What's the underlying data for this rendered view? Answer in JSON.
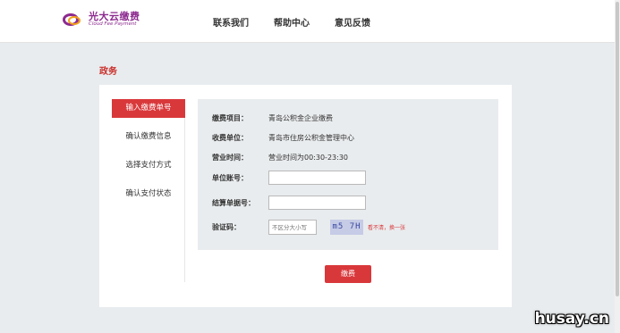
{
  "brand": {
    "name_cn": "光大云缴费",
    "name_en": "Cloud Fee Payment"
  },
  "nav": [
    "联系我们",
    "帮助中心",
    "意见反馈"
  ],
  "section_title": "政务",
  "steps": [
    {
      "label": "输入缴费单号",
      "active": true
    },
    {
      "label": "确认缴费信息",
      "active": false
    },
    {
      "label": "选择支付方式",
      "active": false
    },
    {
      "label": "确认支付状态",
      "active": false
    }
  ],
  "form": {
    "item_label": "缴费项目：",
    "item_value": "青岛公积金企业缴费",
    "payee_label": "收费单位：",
    "payee_value": "青岛市住房公积金管理中心",
    "hours_label": "营业时间：",
    "hours_value": "营业时间为00:30-23:30",
    "account_label": "单位账号：",
    "account_value": "",
    "bill_label": "结算单据号：",
    "bill_value": "",
    "captcha_label": "验证码：",
    "captcha_placeholder": "不区分大小写",
    "captcha_text": "m5 7H",
    "refresh_text": "看不清，换一张"
  },
  "pay_button": "缴费",
  "watermark": "husay.cn",
  "colors": {
    "accent": "#d9383b",
    "brand": "#8c2a8f",
    "brand_secondary": "#f3a21b",
    "panel_bg": "#e9ecee"
  }
}
